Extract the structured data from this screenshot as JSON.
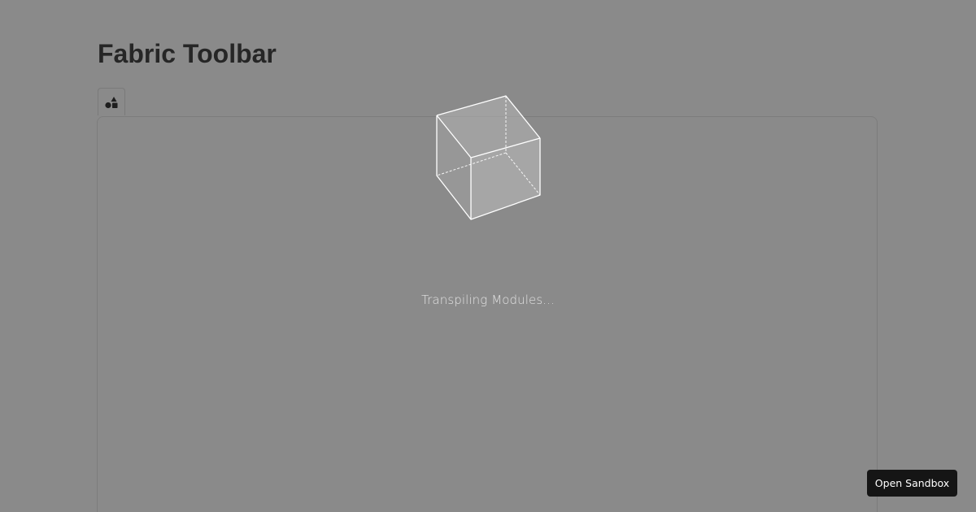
{
  "page": {
    "title": "Fabric Toolbar"
  },
  "toolbar": {
    "shapes_icon": "shapes-icon"
  },
  "loader": {
    "icon": "cube-icon",
    "status_text": "Transpiling Modules..."
  },
  "footer": {
    "open_sandbox_label": "Open Sandbox"
  },
  "colors": {
    "background": "#8a8a8a",
    "title": "#262626",
    "button_dark": "#151515",
    "loader_text": "#e2e2e2"
  }
}
